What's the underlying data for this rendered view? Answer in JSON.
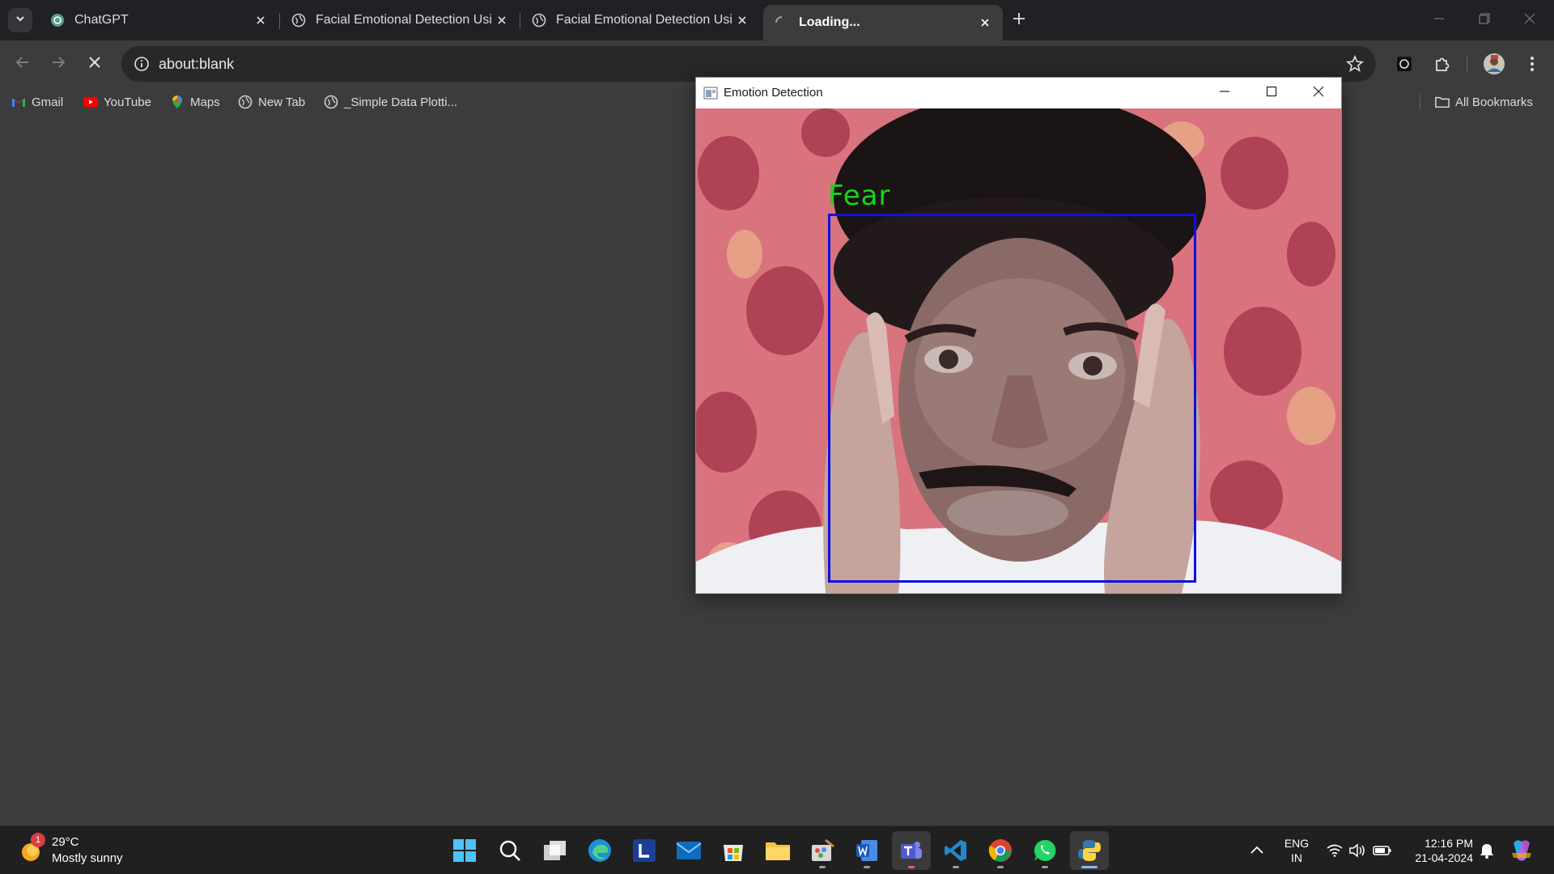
{
  "browser": {
    "tabs": [
      {
        "title": "ChatGPT",
        "favicon": "chatgpt-icon",
        "active": false
      },
      {
        "title": "Facial Emotional Detection Usi",
        "favicon": "globe-icon",
        "active": false
      },
      {
        "title": "Facial Emotional Detection Usi",
        "favicon": "globe-icon",
        "active": false
      },
      {
        "title": "Loading...",
        "favicon": "loading-spinner-icon",
        "active": true
      }
    ],
    "address": "about:blank",
    "bookmarks": [
      {
        "label": "Gmail",
        "icon": "gmail-icon"
      },
      {
        "label": "YouTube",
        "icon": "youtube-icon"
      },
      {
        "label": "Maps",
        "icon": "maps-icon"
      },
      {
        "label": "New Tab",
        "icon": "globe-icon"
      },
      {
        "label": "_Simple Data Plotti...",
        "icon": "globe-icon"
      }
    ],
    "all_bookmarks_label": "All Bookmarks"
  },
  "cv_window": {
    "title": "Emotion Detection",
    "emotion_label": "Fear",
    "label_color": "#14d814",
    "box_color": "#1010e0"
  },
  "taskbar": {
    "weather": {
      "badge": "1",
      "temp": "29°C",
      "condition": "Mostly sunny"
    },
    "apps": [
      "windows-start-icon",
      "search-icon",
      "task-view-icon",
      "edge-icon",
      "l-app-icon",
      "mail-icon",
      "store-icon",
      "file-explorer-icon",
      "paint-icon",
      "word-icon",
      "teams-icon",
      "vscode-icon",
      "chrome-icon",
      "whatsapp-icon",
      "python-icon"
    ],
    "lang_line1": "ENG",
    "lang_line2": "IN",
    "time": "12:16 PM",
    "date": "21-04-2024"
  },
  "colors": {
    "tabstrip_bg": "#202124",
    "toolbar_bg": "#3c3c3c",
    "taskbar_bg": "#202020"
  }
}
